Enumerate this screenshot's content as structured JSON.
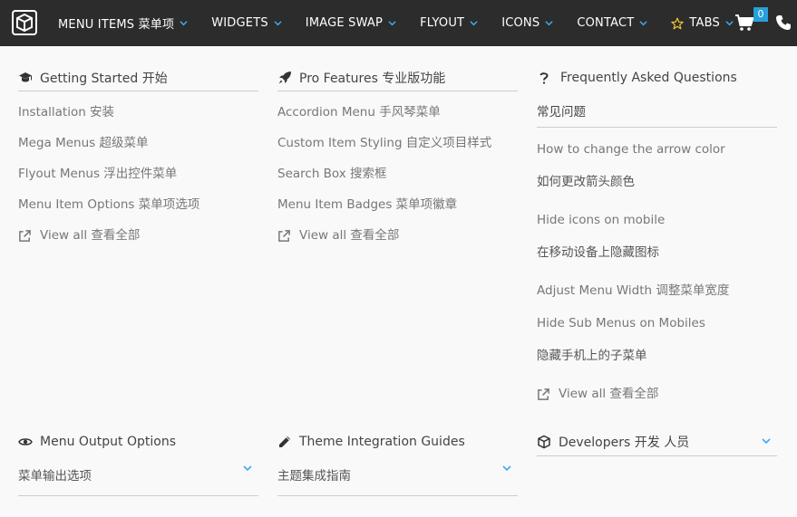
{
  "nav": {
    "items": [
      {
        "label": "MENU ITEMS 菜单项",
        "chevron": true
      },
      {
        "label": "WIDGETS",
        "chevron": true
      },
      {
        "label": "IMAGE SWAP",
        "chevron": true
      },
      {
        "label": "FLYOUT",
        "chevron": true
      },
      {
        "label": "ICONS",
        "chevron": true
      },
      {
        "label": "CONTACT",
        "chevron": true
      },
      {
        "label": "TABS",
        "chevron": true,
        "star": true
      }
    ],
    "cart_count": "0",
    "colors": {
      "bar": "#2c2c2c",
      "text": "#ffffff",
      "chevron": "#3fa9f5",
      "badge": "#26a0da",
      "star": "#f2c12e"
    }
  },
  "columns": {
    "getting_started": {
      "title": "Getting Started 开始",
      "icon": "graduation-cap-icon",
      "items": [
        "Installation 安装",
        "Mega Menus 超级菜单",
        "Flyout Menus 浮出控件菜单",
        "Menu Item Options 菜单项选项"
      ],
      "view_all": "View all 查看全部"
    },
    "pro_features": {
      "title": "Pro Features 专业版功能",
      "icon": "rocket-icon",
      "items": [
        "Accordion Menu 手风琴菜单",
        "Custom Item Styling 自定义项目样式",
        "Search Box 搜索框",
        "Menu Item Badges 菜单项徽章"
      ],
      "view_all": "View all 查看全部"
    },
    "faq": {
      "title": "Frequently Asked Questions",
      "icon": "question-icon",
      "subtitle": "常见问题",
      "items": [
        "How to change the arrow color",
        "如何更改箭头颜色",
        "Hide icons on mobile",
        "在移动设备上隐藏图标",
        "Adjust Menu Width 调整菜单宽度",
        "Hide Sub Menus on Mobiles",
        "隐藏手机上的子菜单"
      ],
      "view_all": "View all 查看全部"
    }
  },
  "accordions": {
    "menu_output": {
      "title": "Menu Output Options",
      "subtitle": "菜单输出选项",
      "icon": "eye-icon"
    },
    "theme_integration": {
      "title": "Theme Integration Guides",
      "subtitle": "主题集成指南",
      "icon": "pencil-icon"
    },
    "developers": {
      "title": "Developers 开发 人员",
      "icon": "cube-icon"
    }
  }
}
